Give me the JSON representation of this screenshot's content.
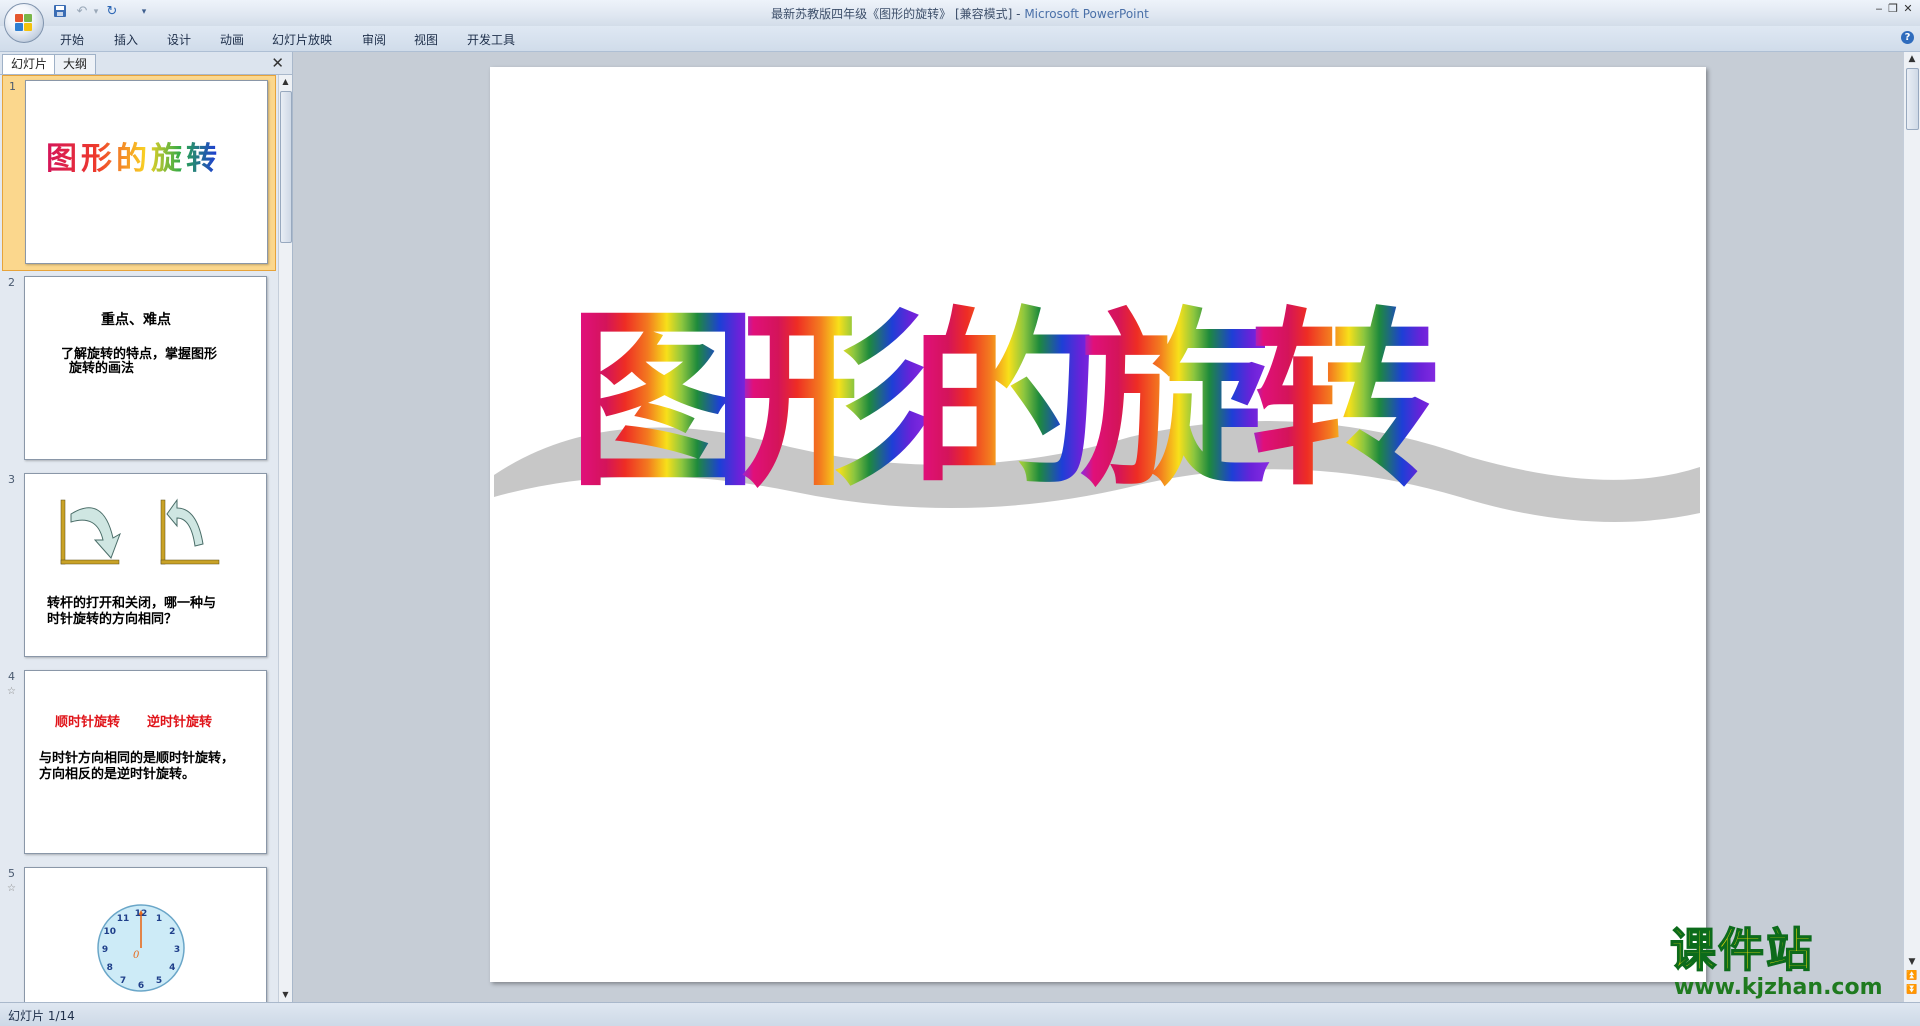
{
  "window": {
    "title": "最新苏教版四年级《图形的旋转》 [兼容模式] - ",
    "app_name": "Microsoft PowerPoint",
    "min_icon": "minimize-icon",
    "max_icon": "restore-icon",
    "close_icon": "close-icon"
  },
  "ribbon": {
    "tabs": [
      "开始",
      "插入",
      "设计",
      "动画",
      "幻灯片放映",
      "审阅",
      "视图",
      "开发工具"
    ],
    "help_label": "?"
  },
  "pane": {
    "tabs": [
      "幻灯片",
      "大纲"
    ],
    "close_label": "✕"
  },
  "slides": [
    {
      "num": "1",
      "title": "图形的旋转"
    },
    {
      "num": "2",
      "heading": "重点、难点",
      "body_line1": "了解旋转的特点，掌握图形",
      "body_line2": "旋转的画法"
    },
    {
      "num": "3",
      "body_line1": "转杆的打开和关闭，哪一种与",
      "body_line2": "时针旋转的方向相同？"
    },
    {
      "num": "4",
      "red1": "顺时针旋转",
      "red2": "逆时针旋转",
      "body_line1": "与时针方向相同的是顺时针旋转，",
      "body_line2": "方向相反的是逆时针旋转。"
    },
    {
      "num": "5",
      "clock_numbers": [
        "12",
        "1",
        "2",
        "3",
        "4",
        "5",
        "6",
        "7",
        "8",
        "9",
        "10",
        "11"
      ],
      "center_label": "0"
    }
  ],
  "main_slide": {
    "title_chars": [
      "图",
      "形",
      "的",
      "旋",
      "转"
    ]
  },
  "status": {
    "text": "幻灯片 1/14"
  },
  "watermark": {
    "cn": "课件站",
    "url": "www.kjzhan.com"
  },
  "colors": {
    "selected_slide_bg": "#fbd78d",
    "ribbon_bg": "#d0dcea",
    "accent": "#2f6cbd"
  }
}
